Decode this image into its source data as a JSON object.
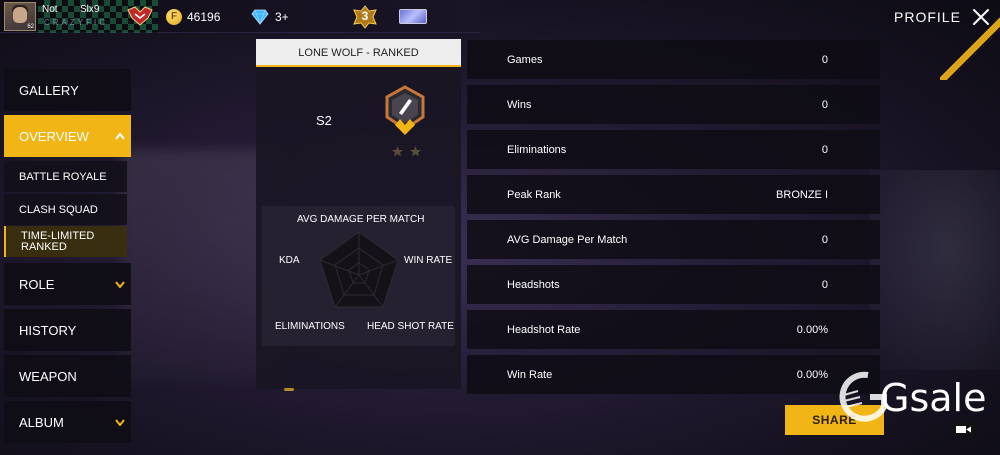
{
  "header": {
    "player_name_1": "Not",
    "player_name_2": "Slx9",
    "guild_tag": "CRAZYFIC",
    "avatar_level": "62",
    "gold": "46196",
    "diamonds": "3+",
    "level_badge": "3",
    "title": "PROFILE"
  },
  "sidebar": {
    "items": [
      {
        "label": "GALLERY"
      },
      {
        "label": "OVERVIEW"
      },
      {
        "label": "ROLE"
      },
      {
        "label": "HISTORY"
      },
      {
        "label": "WEAPON"
      },
      {
        "label": "ALBUM"
      }
    ],
    "sub_items": [
      {
        "label": "BATTLE ROYALE"
      },
      {
        "label": "CLASH SQUAD"
      },
      {
        "label": "TIME-LIMITED RANKED"
      }
    ]
  },
  "mode_card": {
    "title": "LONE WOLF - RANKED",
    "season": "S2",
    "stars_filled": 0,
    "stars_total": 2,
    "radar": {
      "top": "AVG DAMAGE PER MATCH",
      "left": "KDA",
      "right": "WIN RATE",
      "bottom_left": "ELIMINATIONS",
      "bottom_right": "HEAD SHOT RATE"
    }
  },
  "stats": [
    {
      "label": "Games",
      "value": "0"
    },
    {
      "label": "Wins",
      "value": "0"
    },
    {
      "label": "Eliminations",
      "value": "0"
    },
    {
      "label": "Peak Rank",
      "value": "BRONZE I"
    },
    {
      "label": "AVG Damage Per Match",
      "value": "0"
    },
    {
      "label": "Headshots",
      "value": "0"
    },
    {
      "label": "Headshot Rate",
      "value": "0.00%"
    },
    {
      "label": "Win Rate",
      "value": "0.00%"
    }
  ],
  "share_label": "SHARE",
  "watermark": "Gsale",
  "colors": {
    "accent": "#f2b516",
    "panel": "#0e0c14",
    "header_card": "#eeeeee"
  }
}
